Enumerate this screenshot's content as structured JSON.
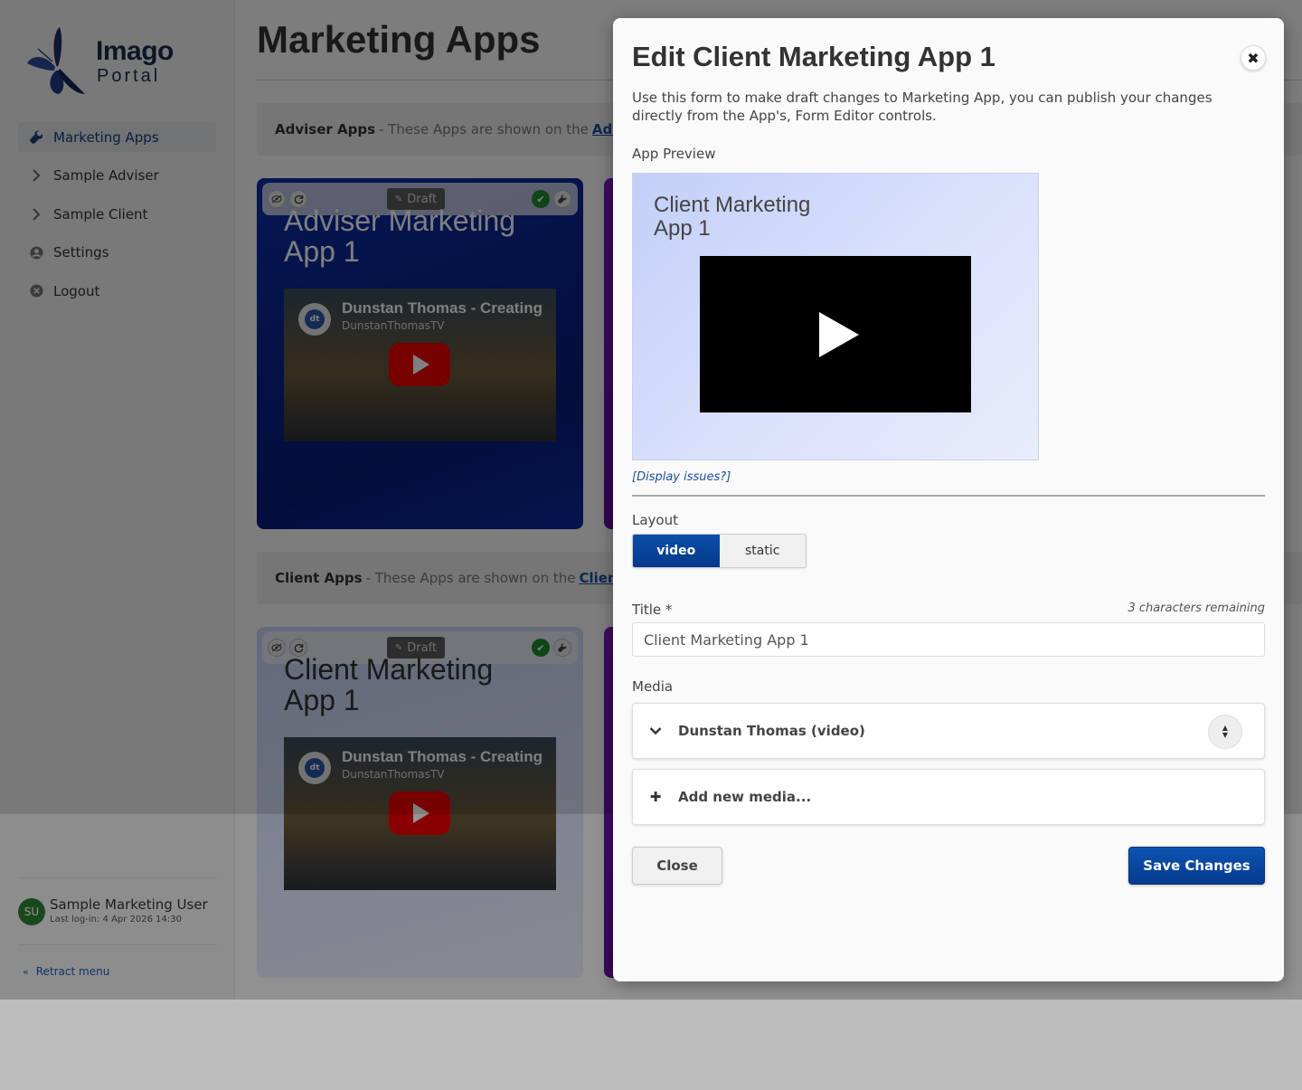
{
  "brand": {
    "line1": "Imago",
    "line2": "Portal",
    "logo_icon": "butterfly-icon",
    "color": "#1b2a4e"
  },
  "sidebar": {
    "items": [
      {
        "label": "Marketing Apps",
        "icon": "wrench-icon",
        "active": true
      },
      {
        "label": "Sample Adviser",
        "icon": "chevron-right-icon"
      },
      {
        "label": "Sample Client",
        "icon": "chevron-right-icon"
      },
      {
        "label": "Settings",
        "icon": "user-circle-icon"
      },
      {
        "label": "Logout",
        "icon": "close-circle-icon"
      }
    ],
    "user": {
      "initials": "SU",
      "name": "Sample Marketing User",
      "last_login": "Last log-in: 4 Apr 2026 14:30"
    },
    "retract_label": "Retract menu"
  },
  "main": {
    "title": "Marketing Apps",
    "adviser_section": {
      "heading": "Adviser Apps",
      "text": "- These Apps are shown on the",
      "link": "Adviser"
    },
    "client_section": {
      "heading": "Client Apps",
      "text": "- These Apps are shown on the",
      "link": "Client Da"
    },
    "cards": {
      "adviser": {
        "title": "Adviser Marketing App 1",
        "draft_label": "Draft",
        "video_title": "Dunstan Thomas - Creating",
        "video_channel": "DunstanThomasTV",
        "channel_badge": "dt"
      },
      "client": {
        "title": "Client Marketing App 1",
        "draft_label": "Draft",
        "video_title": "Dunstan Thomas - Creating",
        "video_channel": "DunstanThomasTV",
        "channel_badge": "dt"
      }
    }
  },
  "modal": {
    "title": "Edit Client Marketing App 1",
    "description": "Use this form to make draft changes to Marketing App, you can publish your changes directly from the App's, Form Editor controls.",
    "preview_label": "App Preview",
    "preview_title": "Client Marketing App 1",
    "display_issues": "[Display issues?]",
    "layout_label": "Layout",
    "layout_options": [
      "video",
      "static"
    ],
    "layout_selected": "video",
    "title_label": "Title *",
    "chars_remaining": "3 characters remaining",
    "title_value": "Client Marketing App 1",
    "media_label": "Media",
    "media_item": "Dunstan Thomas (video)",
    "add_media": "Add new media...",
    "close_label": "Close",
    "save_label": "Save Changes"
  },
  "colors": {
    "primary": "#0b4ea8",
    "adviser_card": "#0b2ea6",
    "client_card": "#c8d4f8",
    "third_card": "#7a16c4",
    "ok_green": "#1f8a2e"
  }
}
